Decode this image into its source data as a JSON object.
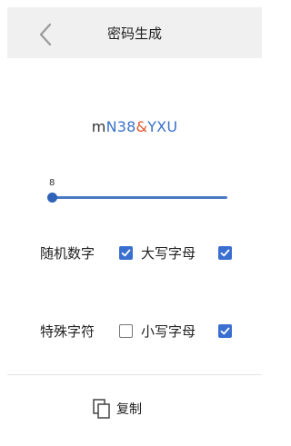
{
  "header": {
    "title": "密码生成",
    "back_icon": "chevron-left-icon"
  },
  "password": {
    "segments": [
      {
        "text": "m",
        "color": "#333333"
      },
      {
        "text": "N38",
        "color": "#3a72c9"
      },
      {
        "text": "&",
        "color": "#e0552a"
      },
      {
        "text": "YXU",
        "color": "#3a72c9"
      }
    ]
  },
  "length_slider": {
    "value": "8",
    "min": 8,
    "max": 32
  },
  "options": {
    "random_digits": {
      "label": "随机数字",
      "checked": true
    },
    "uppercase": {
      "label": "大写字母",
      "checked": true
    },
    "special_chars": {
      "label": "特殊字符",
      "checked": false
    },
    "lowercase": {
      "label": "小写字母",
      "checked": true
    }
  },
  "copy_button": {
    "label": "复制",
    "icon": "copy-icon"
  },
  "colors": {
    "accent": "#3a6fd0",
    "header_bg": "#f0f0f0"
  }
}
